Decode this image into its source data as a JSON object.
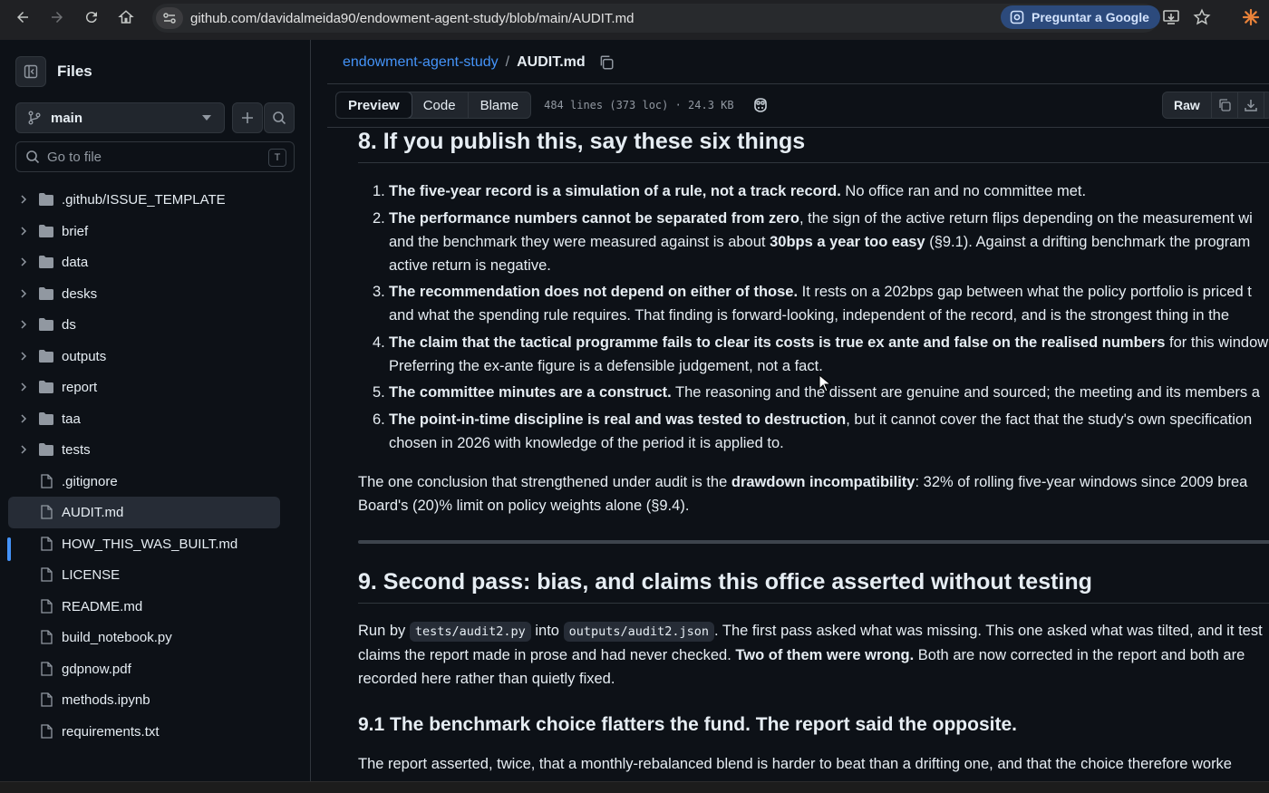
{
  "browser": {
    "url": "github.com/davidalmeida90/endowment-agent-study/blob/main/AUDIT.md",
    "ask_google_label": "Preguntar a Google"
  },
  "sidebar": {
    "title": "Files",
    "branch": "main",
    "goto_placeholder": "Go to file",
    "goto_shortcut": "T",
    "items": [
      {
        "label": ".github/ISSUE_TEMPLATE",
        "type": "folder"
      },
      {
        "label": "brief",
        "type": "folder"
      },
      {
        "label": "data",
        "type": "folder"
      },
      {
        "label": "desks",
        "type": "folder"
      },
      {
        "label": "ds",
        "type": "folder"
      },
      {
        "label": "outputs",
        "type": "folder"
      },
      {
        "label": "report",
        "type": "folder"
      },
      {
        "label": "taa",
        "type": "folder"
      },
      {
        "label": "tests",
        "type": "folder"
      },
      {
        "label": ".gitignore",
        "type": "file"
      },
      {
        "label": "AUDIT.md",
        "type": "file",
        "selected": true
      },
      {
        "label": "HOW_THIS_WAS_BUILT.md",
        "type": "file"
      },
      {
        "label": "LICENSE",
        "type": "file"
      },
      {
        "label": "README.md",
        "type": "file"
      },
      {
        "label": "build_notebook.py",
        "type": "file"
      },
      {
        "label": "gdpnow.pdf",
        "type": "file"
      },
      {
        "label": "methods.ipynb",
        "type": "file"
      },
      {
        "label": "requirements.txt",
        "type": "file"
      }
    ]
  },
  "header": {
    "repo": "endowment-agent-study",
    "separator": "/",
    "file": "AUDIT.md"
  },
  "toolbar": {
    "preview": "Preview",
    "code": "Code",
    "blame": "Blame",
    "meta": "484 lines (373 loc) · 24.3 KB",
    "raw": "Raw"
  },
  "doc": {
    "h8": "8. If you publish this, say these six things",
    "list": [
      {
        "n": "1.",
        "bold": "The five-year record is a simulation of a rule, not a track record.",
        "rest": " No office ran and no committee met."
      },
      {
        "n": "2.",
        "bold": "The performance numbers cannot be separated from zero",
        "rest": ", the sign of the active return flips depending on the measurement wi",
        "line2a": "and the benchmark they were measured against is about ",
        "line2b": "30bps a year too easy",
        "line2c": " (§9.1). Against a drifting benchmark the program",
        "line3": "active return is negative."
      },
      {
        "n": "3.",
        "bold": "The recommendation does not depend on either of those.",
        "rest": " It rests on a 202bps gap between what the policy portfolio is priced t",
        "line2": "and what the spending rule requires. That finding is forward-looking, independent of the record, and is the strongest thing in the"
      },
      {
        "n": "4.",
        "bold": "The claim that the tactical programme fails to clear its costs is true ex ante and false on the realised numbers",
        "rest": " for this window (",
        "line2": "Preferring the ex-ante figure is a defensible judgement, not a fact."
      },
      {
        "n": "5.",
        "bold": "The committee minutes are a construct.",
        "rest": " The reasoning and the dissent are genuine and sourced; the meeting and its members a"
      },
      {
        "n": "6.",
        "bold": "The point-in-time discipline is real and was tested to destruction",
        "rest": ", but it cannot cover the fact that the study's own specification",
        "line2": "chosen in 2026 with knowledge of the period it is applied to."
      }
    ],
    "conclusion_a": "The one conclusion that strengthened under audit is the ",
    "conclusion_b": "drawdown incompatibility",
    "conclusion_c": ": 32% of rolling five-year windows since 2009 brea",
    "conclusion_line2": "Board's (20)% limit on policy weights alone (§9.4).",
    "h9": "9. Second pass: bias, and claims this office asserted without testing",
    "run_a": "Run by ",
    "run_code1": "tests/audit2.py",
    "run_b": " into ",
    "run_code2": "outputs/audit2.json",
    "run_c": ". The first pass asked what was missing. This one asked what was tilted, and it test",
    "run_line2a": "claims the report made in prose and had never checked. ",
    "run_line2b": "Two of them were wrong.",
    "run_line2c": " Both are now corrected in the report and both are",
    "run_line3": "recorded here rather than quietly fixed.",
    "h91": "9.1 The benchmark choice flatters the fund. The report said the opposite.",
    "last": "The report asserted, twice, that a monthly-rebalanced blend is harder to beat than a drifting one, and that the choice therefore worke"
  }
}
